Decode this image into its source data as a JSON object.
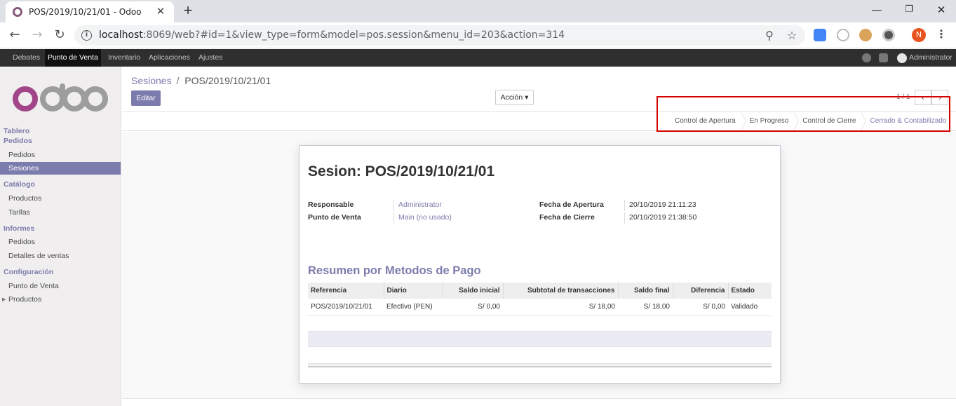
{
  "browser": {
    "tab_title": "POS/2019/10/21/01 - Odoo",
    "tab_close": "✕",
    "new_tab": "+",
    "win_min": "—",
    "win_max": "❐",
    "win_close": "✕",
    "url_host": "localhost",
    "url_rest": ":8069/web?#id=1&view_type=form&model=pos.session&menu_id=203&action=314",
    "profile_initial": "N",
    "icons": [
      "back-icon",
      "forward-icon",
      "reload-icon",
      "info-icon",
      "zoom-icon",
      "star-icon",
      "translate-extension-icon",
      "extension-icon",
      "cookie-extension-icon",
      "extension-icon",
      "menu-icon"
    ]
  },
  "top_menu": {
    "items": [
      "Debates",
      "Punto de Venta",
      "Inventario",
      "Aplicaciones",
      "Ajustes"
    ],
    "active": "Punto de Venta",
    "user": "Administrator"
  },
  "sidebar": {
    "tablero": "Tablero",
    "pedidos_section": "Pedidos",
    "pedidos_items": [
      "Pedidos",
      "Sesiones"
    ],
    "catalogo_section": "Catálogo",
    "catalogo_items": [
      "Productos",
      "Tarifas"
    ],
    "informes_section": "Informes",
    "informes_items": [
      "Pedidos",
      "Detalles de ventas"
    ],
    "config_section": "Configuración",
    "config_items": [
      "Punto de Venta",
      "Productos"
    ],
    "active_item": "Sesiones"
  },
  "control_panel": {
    "breadcrumb_parent": "Sesiones",
    "breadcrumb_sep": "/",
    "breadcrumb_current": "POS/2019/10/21/01",
    "edit_label": "Editar",
    "action_label": "Acción ▾",
    "pager": "1 / 1",
    "pager_prev": "‹",
    "pager_next": "›"
  },
  "statusbar": {
    "stages": [
      "Control de Apertura",
      "En Progreso",
      "Control de Cierre",
      "Cerrado & Contabilizado"
    ],
    "current_stage": "Cerrado & Contabilizado"
  },
  "form": {
    "title": "Sesion: POS/2019/10/21/01",
    "responsable_label": "Responsable",
    "responsable_value": "Administrator",
    "pos_label": "Punto de Venta",
    "pos_value": "Main (no usado)",
    "open_date_label": "Fecha de Apertura",
    "open_date_value": "20/10/2019 21:11:23",
    "close_date_label": "Fecha de Cierre",
    "close_date_value": "20/10/2019 21:38:50",
    "payments_title": "Resumen por Metodos de Pago",
    "payments_columns": [
      "Referencia",
      "Diario",
      "Saldo inicial",
      "Subtotal de transacciones",
      "Saldo final",
      "Diferencia",
      "Estado"
    ],
    "payments_rows": [
      [
        "POS/2019/10/21/01",
        "Efectivo (PEN)",
        "S/ 0,00",
        "S/ 18,00",
        "S/ 18,00",
        "S/ 0,00",
        "Validado"
      ]
    ]
  },
  "colors": {
    "odoo_primary": "#7c7bad",
    "highlight_box": "#d40000",
    "top_bar": "#2f2f2f"
  }
}
